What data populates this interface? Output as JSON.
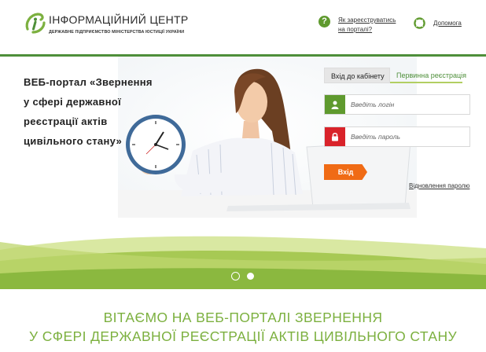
{
  "header": {
    "org_title": "ІНФОРМАЦІЙНИЙ ЦЕНТР",
    "org_subtitle": "ДЕРЖАВНЕ ПІДПРИЄМСТВО МІНІСТЕРСТВА ЮСТИЦІЇ УКРАЇНИ",
    "help_icon_glyph": "?",
    "help_link_line1": "Як зареєструватись",
    "help_link_line2": "на порталі?",
    "support_link": "Допомога",
    "accent_color": "#4e8f3a"
  },
  "hero": {
    "title_lines": [
      "ВЕБ-портал «Звернення",
      "у сфері державної",
      "реєстрації актів",
      "цивільного стану»"
    ]
  },
  "login": {
    "tabs": [
      {
        "label": "Вхід до кабінету",
        "active": true
      },
      {
        "label": "Первинна реєстрація",
        "active": false
      }
    ],
    "login_placeholder": "Введіть логін",
    "password_placeholder": "Введіть пароль",
    "submit_label": "Вхід",
    "recover_label": "Відновлення паролю",
    "login_icon": "user-icon",
    "password_icon": "lock-icon"
  },
  "carousel": {
    "slides": 2,
    "active_index": 0
  },
  "welcome": {
    "line1": "ВІТАЄМО НА ВЕБ-ПОРТАЛІ ЗВЕРНЕННЯ",
    "line2": "У СФЕРІ ДЕРЖАВНОЇ РЕЄСТРАЦІЇ АКТІВ ЦИВІЛЬНОГО СТАНУ",
    "color": "#7cb03f"
  }
}
